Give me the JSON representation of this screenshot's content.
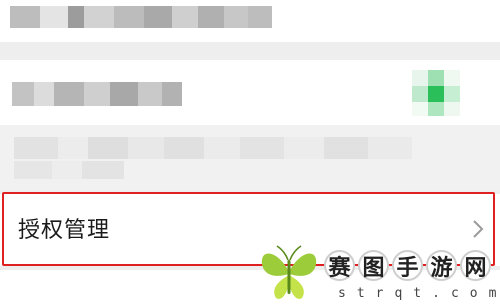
{
  "auth_item": {
    "label": "授权管理",
    "chevron": "chevron-right-icon"
  },
  "watermark": {
    "chars": [
      "赛",
      "图",
      "手",
      "游",
      "网"
    ],
    "domain_text": "strqt.com"
  },
  "colors": {
    "highlight_border": "#e02020",
    "toggle_green": "#2bbf5a"
  }
}
